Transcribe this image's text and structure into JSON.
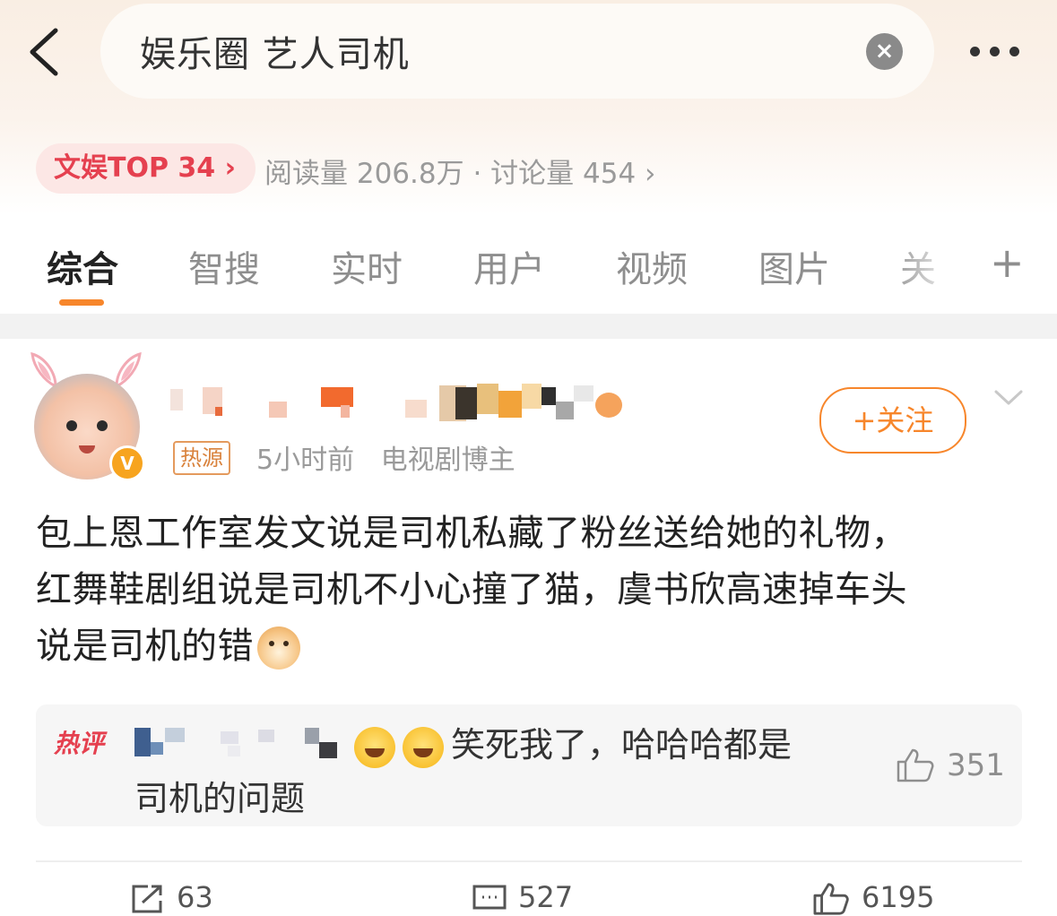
{
  "header": {
    "search_query": "娱乐圈 艺人司机",
    "clear_icon": "close-circle-icon",
    "back_icon": "chevron-left-icon",
    "more_icon": "more-dots-icon"
  },
  "topic": {
    "rank_badge": "文娱TOP 34 ›",
    "stats": "阅读量 206.8万 · 讨论量 454 ›",
    "badge_color": "#e5404f"
  },
  "tabs": [
    {
      "label": "综合",
      "active": true
    },
    {
      "label": "智搜"
    },
    {
      "label": "实时"
    },
    {
      "label": "用户"
    },
    {
      "label": "视频"
    },
    {
      "label": "图片"
    },
    {
      "label": "关"
    }
  ],
  "tab_accent": "#f7862b",
  "post": {
    "source_badge": "热源",
    "time": "5小时前",
    "category": "电视剧博主",
    "follow_label": "+关注",
    "verified_mark": "V",
    "content_lines": [
      "包上恩工作室发文说是司机私藏了粉丝送给她的礼物，",
      "红舞鞋剧组说是司机不小心撞了猫，虞书欣高速掉车头",
      "说是司机的错"
    ]
  },
  "hot_comment": {
    "label": "热评",
    "text_line1": "笑死我了，哈哈哈都是",
    "text_line2": "司机的问题",
    "likes": "351"
  },
  "actions": {
    "reposts": "63",
    "comments": "527",
    "likes": "6195"
  }
}
